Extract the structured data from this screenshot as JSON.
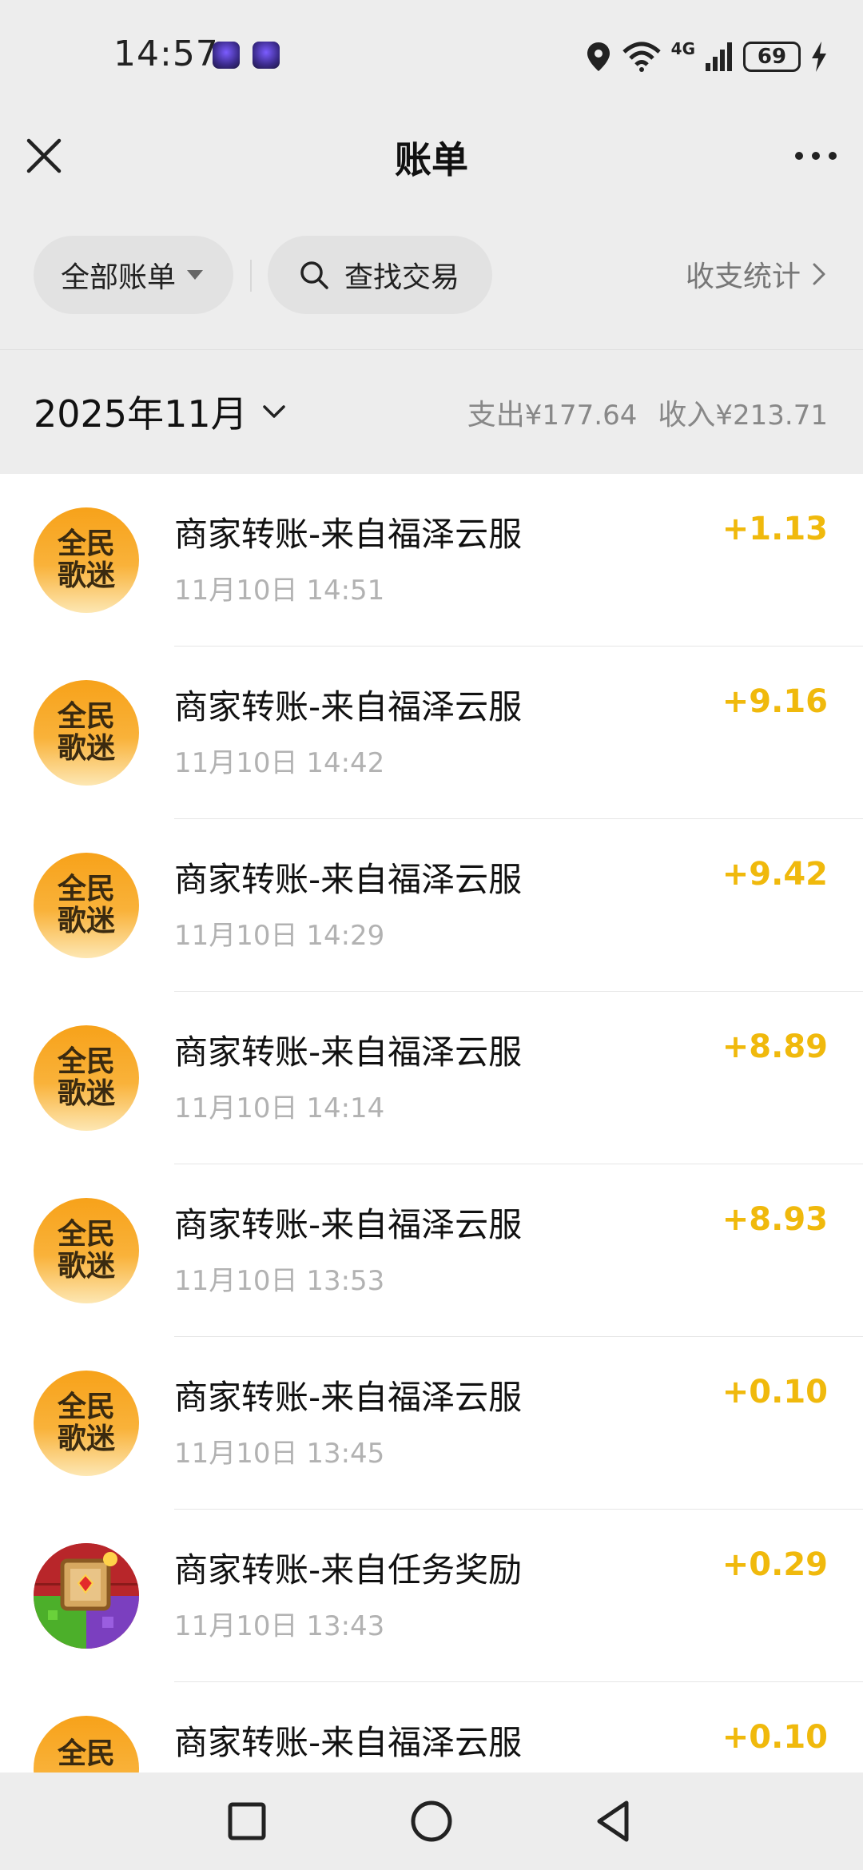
{
  "status_bar": {
    "time": "14:57",
    "network": "4G",
    "battery": "69",
    "icons": [
      "app-notification-icon",
      "app-notification-icon",
      "location-icon",
      "wifi-icon",
      "signal-icon",
      "battery-icon",
      "charging-icon"
    ]
  },
  "nav": {
    "title": "账单",
    "close_icon": "close-icon",
    "more_icon": "more-icon"
  },
  "filter": {
    "all_label": "全部账单",
    "search_label": "查找交易",
    "stats_label": "收支统计"
  },
  "month": {
    "label": "2025年11月",
    "expense_label": "支出",
    "expense_value": "¥177.64",
    "income_label": "收入",
    "income_value": "¥213.71"
  },
  "transactions": [
    {
      "avatar": "全民歌迷",
      "avatar_line1": "全民",
      "avatar_line2": "歌迷",
      "title": "商家转账-来自福泽云服",
      "time": "11月10日 14:51",
      "amount": "+1.13"
    },
    {
      "avatar": "全民歌迷",
      "avatar_line1": "全民",
      "avatar_line2": "歌迷",
      "title": "商家转账-来自福泽云服",
      "time": "11月10日 14:42",
      "amount": "+9.16"
    },
    {
      "avatar": "全民歌迷",
      "avatar_line1": "全民",
      "avatar_line2": "歌迷",
      "title": "商家转账-来自福泽云服",
      "time": "11月10日 14:29",
      "amount": "+9.42"
    },
    {
      "avatar": "全民歌迷",
      "avatar_line1": "全民",
      "avatar_line2": "歌迷",
      "title": "商家转账-来自福泽云服",
      "time": "11月10日 14:14",
      "amount": "+8.89"
    },
    {
      "avatar": "全民歌迷",
      "avatar_line1": "全民",
      "avatar_line2": "歌迷",
      "title": "商家转账-来自福泽云服",
      "time": "11月10日 13:53",
      "amount": "+8.93"
    },
    {
      "avatar": "全民歌迷",
      "avatar_line1": "全民",
      "avatar_line2": "歌迷",
      "title": "商家转账-来自福泽云服",
      "time": "11月10日 13:45",
      "amount": "+0.10"
    },
    {
      "avatar": "game-icon",
      "avatar_line1": "",
      "avatar_line2": "",
      "title": "商家转账-来自任务奖励",
      "time": "11月10日 13:43",
      "amount": "+0.29"
    },
    {
      "avatar": "全民歌迷",
      "avatar_line1": "全民",
      "avatar_line2": "",
      "title": "商家转账-来自福泽云服",
      "time": "",
      "amount": "+0.10"
    }
  ],
  "system_nav": {
    "icons": [
      "recent-apps-icon",
      "home-icon",
      "back-icon"
    ]
  },
  "colors": {
    "background": "#ededed",
    "income_amount": "#f0b90c",
    "avatar_orange": "#f7a21a"
  }
}
